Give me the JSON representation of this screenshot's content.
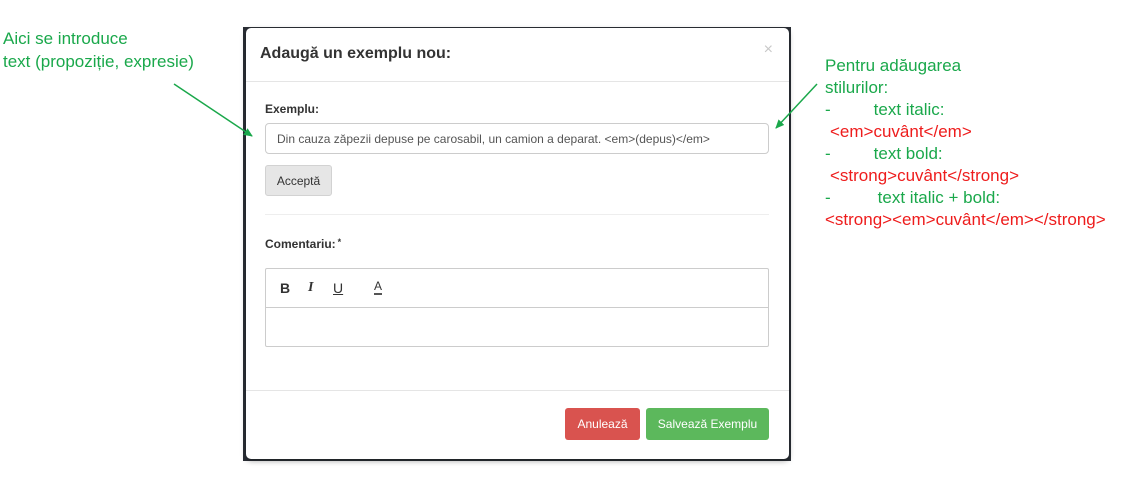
{
  "modal": {
    "title": "Adaugă un exemplu nou:",
    "close_symbol": "×",
    "example_label": "Exemplu:",
    "example_value": "Din cauza zăpezii depuse pe carosabil, un camion a deparat. <em>(depus)</em>",
    "accept_label": "Acceptă",
    "comment_label": "Comentariu:",
    "required_mark": "*",
    "toolbar": {
      "bold": "B",
      "italic": "I",
      "underline": "U",
      "color": "A"
    },
    "cancel_label": "Anulează",
    "save_label": "Salvează Exemplu"
  },
  "annotations": {
    "left": [
      "Aici se introduce",
      "text (propoziție, expresie)"
    ],
    "right_title": [
      "Pentru adăugarea",
      "stilurilor:"
    ],
    "right_items": [
      {
        "bullet": "-",
        "label": "text italic:",
        "code": "<em>cuvânt</em>"
      },
      {
        "bullet": "-",
        "label": "text bold:",
        "code": "<strong>cuvânt</strong>"
      },
      {
        "bullet": "-",
        "label": "text italic + bold:",
        "code": "<strong><em>cuvânt</em></strong>"
      }
    ],
    "colors": {
      "green": "#1aa84b",
      "red": "#ee1c1c"
    }
  }
}
